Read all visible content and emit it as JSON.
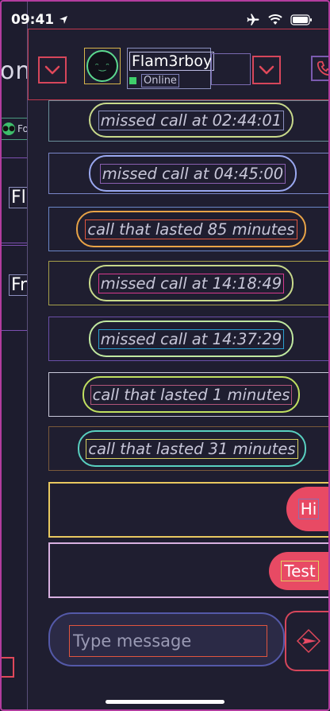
{
  "status_bar": {
    "time": "09:41"
  },
  "background_screen": {
    "title_fragment": "ons",
    "chip_text": "Fo",
    "row_labels": [
      "Fl",
      "Fr"
    ]
  },
  "header": {
    "contact_name": "Flam3rboy",
    "status": "Online"
  },
  "messages": [
    {
      "kind": "system",
      "text": "missed call at 02:44:01"
    },
    {
      "kind": "system",
      "text": "missed call at 04:45:00"
    },
    {
      "kind": "system",
      "text": "call that lasted 85 minutes"
    },
    {
      "kind": "system",
      "text": "missed call at 14:18:49"
    },
    {
      "kind": "system",
      "text": "missed call at 14:37:29"
    },
    {
      "kind": "system",
      "text": "call that lasted 1 minutes"
    },
    {
      "kind": "system",
      "text": "call that lasted 31 minutes"
    },
    {
      "kind": "outgoing",
      "text": "Hi"
    },
    {
      "kind": "outgoing",
      "text": "Test"
    }
  ],
  "composer": {
    "placeholder": "Type message"
  },
  "colors": {
    "accent": "#e84a64",
    "online": "#3fce6b",
    "background": "#1f1e30"
  }
}
